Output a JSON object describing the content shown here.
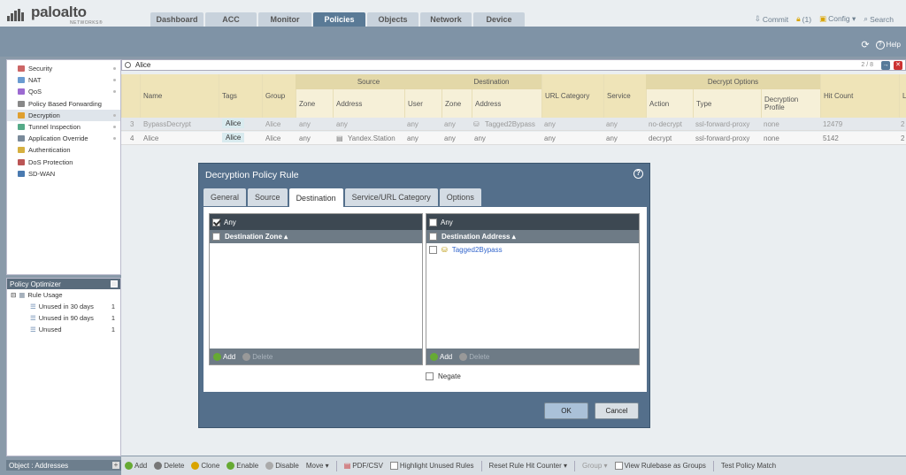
{
  "brand": {
    "name": "paloalto",
    "sub": "NETWORKS®"
  },
  "tabs": [
    "Dashboard",
    "ACC",
    "Monitor",
    "Policies",
    "Objects",
    "Network",
    "Device"
  ],
  "header_actions": {
    "commit": "Commit",
    "locks": "(1)",
    "config": "Config ▾",
    "search": "Search"
  },
  "help": "Help",
  "nav": [
    "Security",
    "NAT",
    "QoS",
    "Policy Based Forwarding",
    "Decryption",
    "Tunnel Inspection",
    "Application Override",
    "Authentication",
    "DoS Protection",
    "SD-WAN"
  ],
  "optimizer": {
    "title": "Policy Optimizer",
    "rule_usage": "Rule Usage",
    "rows": [
      {
        "label": "Unused in 30 days",
        "count": "1"
      },
      {
        "label": "Unused in 90 days",
        "count": "1"
      },
      {
        "label": "Unused",
        "count": "1"
      }
    ]
  },
  "object_panel": "Object : Addresses",
  "search": {
    "value": "Alice",
    "count": "2 / 8",
    "go": "→",
    "clear": "✕"
  },
  "table": {
    "groups": {
      "source": "Source",
      "destination": "Destination",
      "decrypt": "Decrypt Options"
    },
    "columns": {
      "name": "Name",
      "tags": "Tags",
      "group": "Group",
      "src_zone": "Zone",
      "src_addr": "Address",
      "user": "User",
      "dst_zone": "Zone",
      "dst_addr": "Address",
      "url": "URL Category",
      "service": "Service",
      "action": "Action",
      "type": "Type",
      "profile": "Decryption Profile",
      "hits": "Hit Count",
      "last": "L"
    },
    "rows": [
      {
        "num": "3",
        "name": "BypassDecrypt",
        "tag": "Alice",
        "group": "Alice",
        "src_zone": "any",
        "src_addr": "any",
        "user": "any",
        "dst_zone": "any",
        "dst_addr": "Tagged2Bypass",
        "url": "any",
        "service": "any",
        "action": "no-decrypt",
        "type": "ssl-forward-proxy",
        "profile": "none",
        "hits": "12479",
        "last": "2"
      },
      {
        "num": "4",
        "name": "Alice",
        "tag": "Alice",
        "group": "Alice",
        "src_zone": "any",
        "src_addr": "Yandex.Station",
        "user": "any",
        "dst_zone": "any",
        "dst_addr": "any",
        "url": "any",
        "service": "any",
        "action": "decrypt",
        "type": "ssl-forward-proxy",
        "profile": "none",
        "hits": "5142",
        "last": "2"
      }
    ]
  },
  "bottom": {
    "add": "Add",
    "delete": "Delete",
    "clone": "Clone",
    "enable": "Enable",
    "disable": "Disable",
    "move": "Move ▾",
    "pdf": "PDF/CSV",
    "highlight": "Highlight Unused Rules",
    "reset": "Reset Rule Hit Counter ▾",
    "group": "Group ▾",
    "view_groups": "View Rulebase as Groups",
    "test": "Test Policy Match"
  },
  "dialog": {
    "title": "Decryption Policy Rule",
    "help": "?",
    "tabs": [
      "General",
      "Source",
      "Destination",
      "Service/URL Category",
      "Options"
    ],
    "left": {
      "any": "Any",
      "header": "Destination Zone ▴",
      "add": "Add",
      "delete": "Delete"
    },
    "right": {
      "any": "Any",
      "header": "Destination Address ▴",
      "items": [
        "Tagged2Bypass"
      ],
      "add": "Add",
      "delete": "Delete"
    },
    "negate": "Negate",
    "ok": "OK",
    "cancel": "Cancel"
  }
}
